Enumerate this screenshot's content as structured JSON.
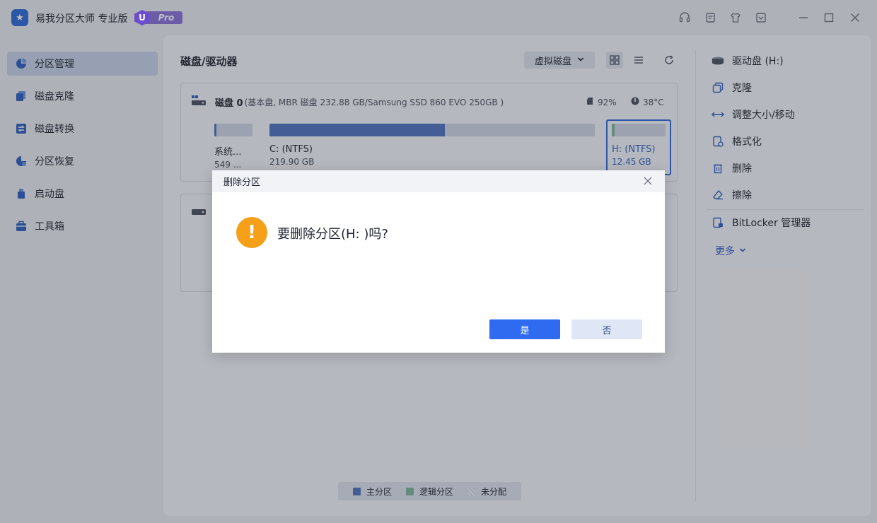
{
  "app": {
    "title": "易我分区大师 专业版",
    "badge_letter": "U",
    "badge_text": "Pro"
  },
  "sidebar": {
    "items": [
      {
        "label": "分区管理",
        "icon": "pie-chart-icon"
      },
      {
        "label": "磁盘克隆",
        "icon": "copy-icon"
      },
      {
        "label": "磁盘转换",
        "icon": "convert-icon"
      },
      {
        "label": "分区恢复",
        "icon": "recovery-icon"
      },
      {
        "label": "启动盘",
        "icon": "usb-icon"
      },
      {
        "label": "工具箱",
        "icon": "toolbox-icon"
      }
    ]
  },
  "main": {
    "title": "磁盘/驱动器",
    "virtual_disk_label": "虚拟磁盘",
    "disk0": {
      "name": "磁盘 0",
      "info": "(基本盘, MBR 磁盘 232.88 GB/Samsung SSD 860 EVO 250GB )",
      "usage": "92%",
      "temperature": "38°C",
      "partitions": [
        {
          "label": "系统...",
          "size": "549 ...",
          "used_fraction": 0.05
        },
        {
          "label": "C: (NTFS)",
          "size": "219.90 GB",
          "used_fraction": 0.54
        },
        {
          "label": "H: (NTFS)",
          "size": "12.45 GB",
          "used_fraction": 0.05
        }
      ]
    },
    "legend": {
      "primary": "主分区",
      "logical": "逻辑分区",
      "unallocated": "未分配"
    }
  },
  "right_panel": {
    "drive_title": "驱动盘 (H:)",
    "actions": [
      {
        "label": "克隆",
        "icon": "clone-icon"
      },
      {
        "label": "调整大小/移动",
        "icon": "resize-icon"
      },
      {
        "label": "格式化",
        "icon": "format-icon"
      },
      {
        "label": "删除",
        "icon": "trash-icon"
      },
      {
        "label": "擦除",
        "icon": "eraser-icon"
      }
    ],
    "bitlocker": "BitLocker 管理器",
    "more": "更多"
  },
  "dialog": {
    "title": "删除分区",
    "message": "要删除分区(H: )吗?",
    "yes": "是",
    "no": "否"
  },
  "colors": {
    "accent": "#2f6bf0",
    "primary_partition": "#4f74c0",
    "logical_partition": "#7fb79a",
    "warning": "#f6a019"
  }
}
